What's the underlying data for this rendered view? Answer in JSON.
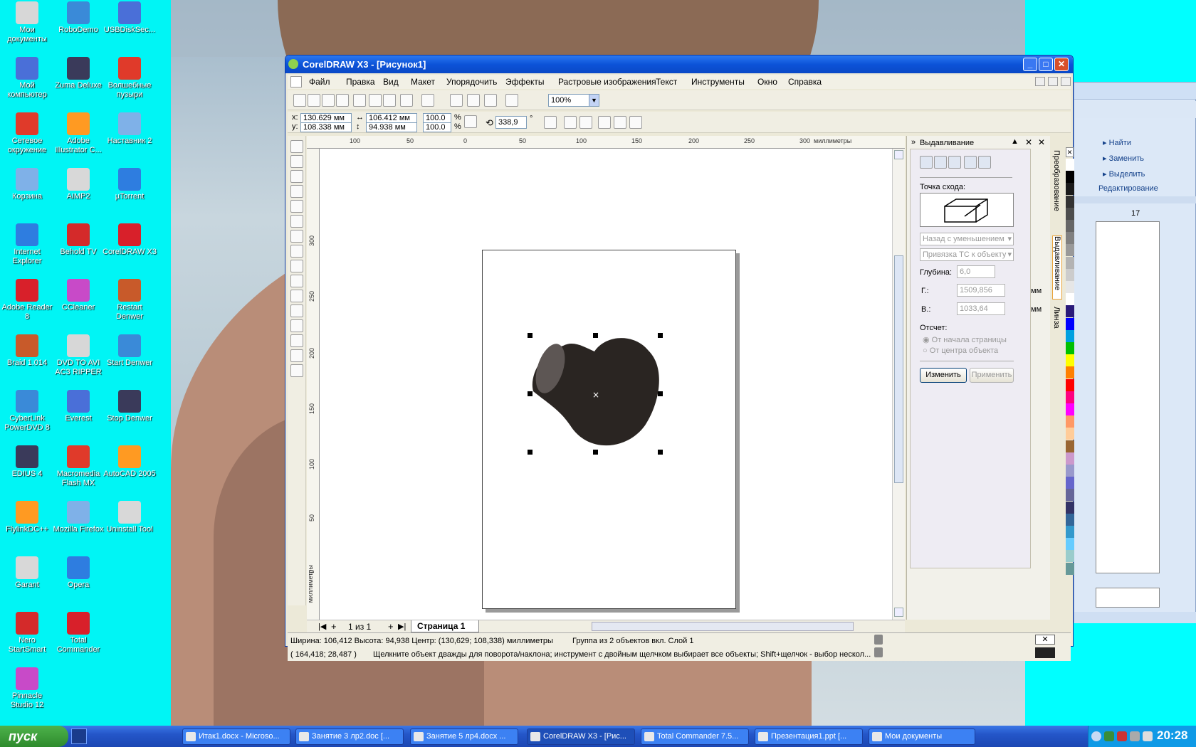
{
  "desktop": {
    "icons_col1": [
      "Мои документы",
      "Мой компьютер",
      "Сетевое окружение",
      "Корзина",
      "Internet Explorer",
      "Adobe Reader 8",
      "Braid 1.014",
      "CyberLink PowerDVD 8",
      "EDIUS 4",
      "FlylinkDC++",
      "Garant",
      "Nero StartSmart",
      "Pinnacle Studio 12"
    ],
    "icons_col2": [
      "RoboDemo",
      "Zuma Deluxe",
      "Adobe Illustrator C...",
      "AIMP2",
      "Behold TV",
      "CCleaner",
      "DVD TO AVI AC3 RIPPER",
      "Everest",
      "Macromedia Flash MX",
      "Mozilla Firefox",
      "Opera",
      "Total Commander"
    ],
    "icons_col3": [
      "USBDiskSec...",
      "Волшебные пузыри",
      "Наставник 2",
      "µTorrent",
      "CorelDRAW X3",
      "Restart Denwer",
      "Start Denwer",
      "Stop Denwer",
      "AutoCAD 2005",
      "Uninstall Tool"
    ]
  },
  "taskbar": {
    "start": "пуск",
    "items": [
      "Итак1.docx - Microso...",
      "Занятие 3 лр2.doc [...",
      "Занятие 5 лр4.docx ...",
      "CorelDRAW X3 - [Рис...",
      "Total Commander 7.5...",
      "Презентация1.ppt [...",
      "Мои документы"
    ],
    "clock": "20:28"
  },
  "window": {
    "title": "CorelDRAW X3 - [Рисунок1]",
    "menu": [
      "Файл",
      "Правка",
      "Вид",
      "Макет",
      "Упорядочить",
      "Эффекты",
      "Растровые изображения",
      "Текст",
      "Инструменты",
      "Окно",
      "Справка"
    ],
    "zoom": "100%",
    "props": {
      "x": "130.629 мм",
      "y": "108.338 мм",
      "w": "106.412 мм",
      "h": "94.938 мм",
      "sx": "100.0",
      "sy": "100.0",
      "pct": "%",
      "angle": "338,9",
      "deg": "°"
    },
    "ruler_unit": "миллиметры",
    "hruler": [
      "100",
      "50",
      "0",
      "50",
      "100",
      "150",
      "200",
      "250",
      "300"
    ],
    "vruler": [
      "300",
      "250",
      "200",
      "150",
      "100",
      "50",
      "0"
    ],
    "page_nav": "1 из 1",
    "page_tab": "Страница 1",
    "status_line1": "Ширина: 106,412 Высота: 94,938 Центр: (130,629; 108,338) миллиметры",
    "status_group": "Группа из 2 объектов вкл. Слой 1",
    "status_line2": "( 164,418; 28,487 )",
    "status_hint": "Щелкните объект дважды для поворота/наклона; инструмент с двойным щелчком выбирает все объекты; Shift+щелчок - выбор нескол..."
  },
  "docker": {
    "title": "Выдавливание",
    "vanish_label": "Точка схода:",
    "dropdown1": "Назад с уменьшением",
    "dropdown2": "Привязка ТС к объекту",
    "depth_label": "Глубина:",
    "depth": "6,0",
    "h_label": "Г.:",
    "h_value": "1509,856",
    "v_label": "В.:",
    "v_value": "1033,64",
    "unit": "мм",
    "origin_label": "Отсчет:",
    "radio1": "От начала страницы",
    "radio2": "От центра объекта",
    "edit_btn": "Изменить",
    "apply_btn": "Применить",
    "tabs": [
      "Преобразование",
      "Выдавливание",
      "Линза"
    ]
  },
  "word": {
    "find": "Найти",
    "replace": "Заменить",
    "select": "Выделить",
    "group": "Редактирование",
    "ruler": "17"
  },
  "palette": [
    "#ffffff",
    "#000000",
    "#1a1a1a",
    "#333333",
    "#4d4d4d",
    "#666666",
    "#808080",
    "#999999",
    "#b3b3b3",
    "#cccccc",
    "#e6e6e6",
    "#ffffff",
    "#2a1a7a",
    "#0000ff",
    "#00a0e0",
    "#00c000",
    "#ffff00",
    "#ff8000",
    "#ff0000",
    "#ff0080",
    "#ff00ff",
    "#ff9966",
    "#ffcc99",
    "#996633",
    "#cc99cc",
    "#9999cc",
    "#6666cc",
    "#666699",
    "#333366",
    "#336699",
    "#3399cc",
    "#66ccff",
    "#99cccc",
    "#669999"
  ]
}
